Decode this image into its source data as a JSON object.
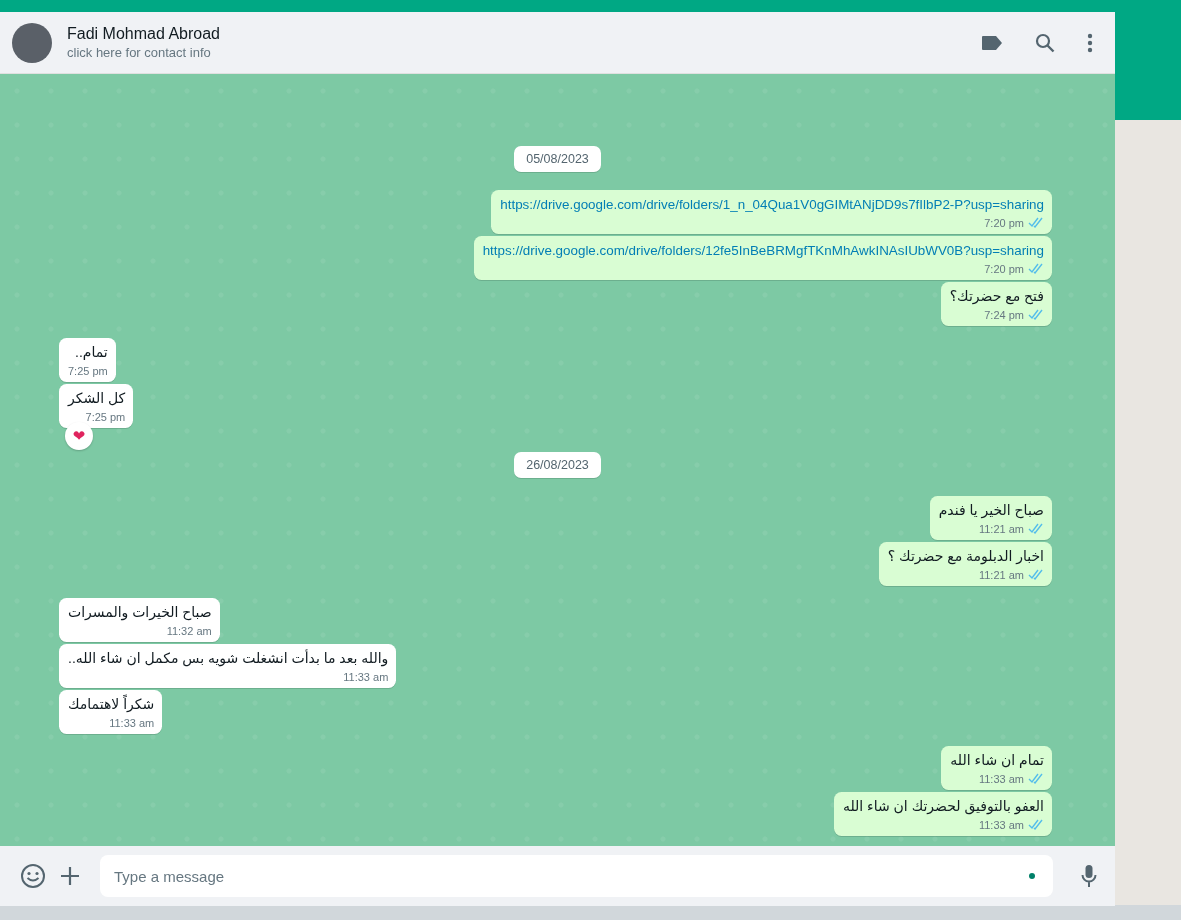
{
  "header": {
    "name": "Fadi Mohmad Abroad",
    "subtitle": "click here for contact info"
  },
  "messages": [
    {
      "kind": "date",
      "text": "05/08/2023"
    },
    {
      "kind": "out",
      "text": "https://drive.google.com/drive/folders/1_n_04Qua1V0gGIMtANjDD9s7fIlbP2-P?usp=sharing",
      "link": true,
      "time": "7:20 pm",
      "read": true
    },
    {
      "kind": "out",
      "text": "https://drive.google.com/drive/folders/12fe5InBeBRMgfTKnMhAwkINAsIUbWV0B?usp=sharing",
      "link": true,
      "time": "7:20 pm",
      "read": true
    },
    {
      "kind": "out",
      "text": "فتح مع حضرتك؟",
      "time": "7:24 pm",
      "read": true
    },
    {
      "kind": "in",
      "text": "تمام..",
      "time": "7:25 pm"
    },
    {
      "kind": "in",
      "text": "كل الشكر",
      "time": "7:25 pm",
      "reaction": "❤"
    },
    {
      "kind": "date",
      "text": "26/08/2023"
    },
    {
      "kind": "out",
      "text": "صباح الخير يا فندم",
      "time": "11:21 am",
      "read": true
    },
    {
      "kind": "out",
      "text": "اخبار الدبلومة مع حضرتك ؟",
      "time": "11:21 am",
      "read": true
    },
    {
      "kind": "in",
      "text": "صباح الخيرات والمسرات",
      "time": "11:32 am"
    },
    {
      "kind": "in",
      "text": "والله بعد ما بدأت انشغلت شويه بس مكمل ان شاء الله..",
      "time": "11:33 am"
    },
    {
      "kind": "in",
      "text": "شكراً لاهتمامك",
      "time": "11:33 am"
    },
    {
      "kind": "out",
      "text": "تمام ان شاء الله",
      "time": "11:33 am",
      "read": true
    },
    {
      "kind": "out",
      "text": "العفو بالتوفيق لحضرتك ان شاء الله",
      "time": "11:33 am",
      "read": true
    }
  ],
  "composer": {
    "placeholder": "Type a message"
  }
}
